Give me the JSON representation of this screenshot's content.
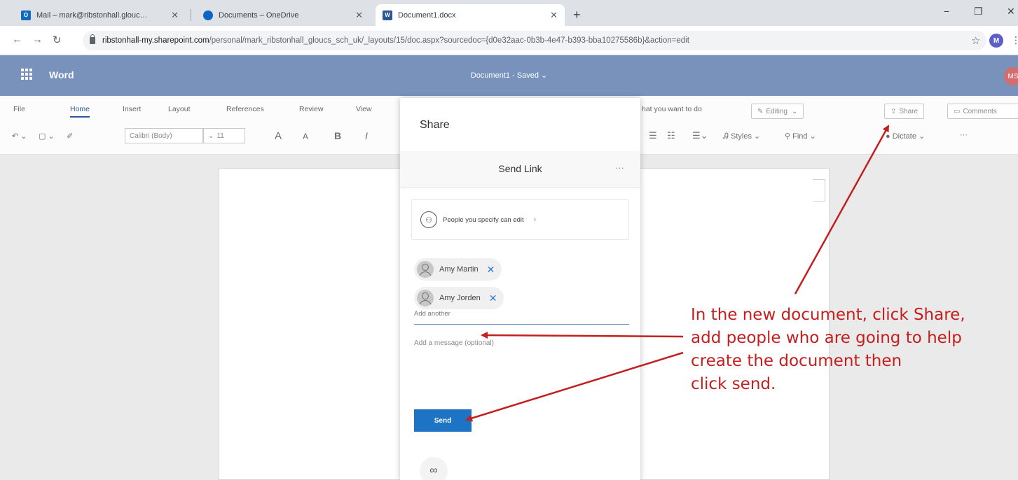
{
  "browser": {
    "tabs": [
      {
        "title": "Mail – mark@ribstonhall.glouc…",
        "icon": "outlook-icon",
        "active": false
      },
      {
        "title": "Documents – OneDrive",
        "icon": "onedrive-icon",
        "active": false
      },
      {
        "title": "Document1.docx",
        "icon": "word-icon",
        "active": true
      }
    ],
    "new_tab": "+",
    "window_controls": {
      "minimize": "−",
      "restore": "❐",
      "close": "✕"
    },
    "url_host": "ribstonhall-my.sharepoint.com",
    "url_path": "/personal/mark_ribstonhall_gloucs_sch_uk/_layouts/15/doc.aspx?sourcedoc={d0e32aac-0b3b-4e47-b393-bba10275586b}&action=edit",
    "profile_initial": "M"
  },
  "app": {
    "name": "Word",
    "document_title": "Document1 - Saved ⌄",
    "user_initials": "MS",
    "accent": "#2b579a"
  },
  "ribbon": {
    "tabs": [
      "File",
      "Home",
      "Insert",
      "Layout",
      "References",
      "Review",
      "View"
    ],
    "tell_me": "hat you want to do",
    "editing": "Editing",
    "share": "Share",
    "comments": "Comments",
    "font_name": "Calibri (Body)",
    "font_size": "11",
    "grow": "A",
    "shrink": "A",
    "bold": "B",
    "italic": "I",
    "styles": "Styles",
    "find": "Find",
    "dictate": "Dictate",
    "more": "···"
  },
  "share_panel": {
    "title": "Share",
    "subtitle": "Send Link",
    "more": "···",
    "permission": "People you specify can edit",
    "recipients": [
      "Amy Martin",
      "Amy Jorden"
    ],
    "add_placeholder": "Add another",
    "message_placeholder": "Add a message (optional)",
    "send": "Send",
    "send_color": "#1d73c4"
  },
  "annotation": {
    "lines": [
      "In the new document, click Share,",
      "add people who are going to help",
      "create the document then",
      "click send."
    ],
    "color": "#c41e1e"
  }
}
